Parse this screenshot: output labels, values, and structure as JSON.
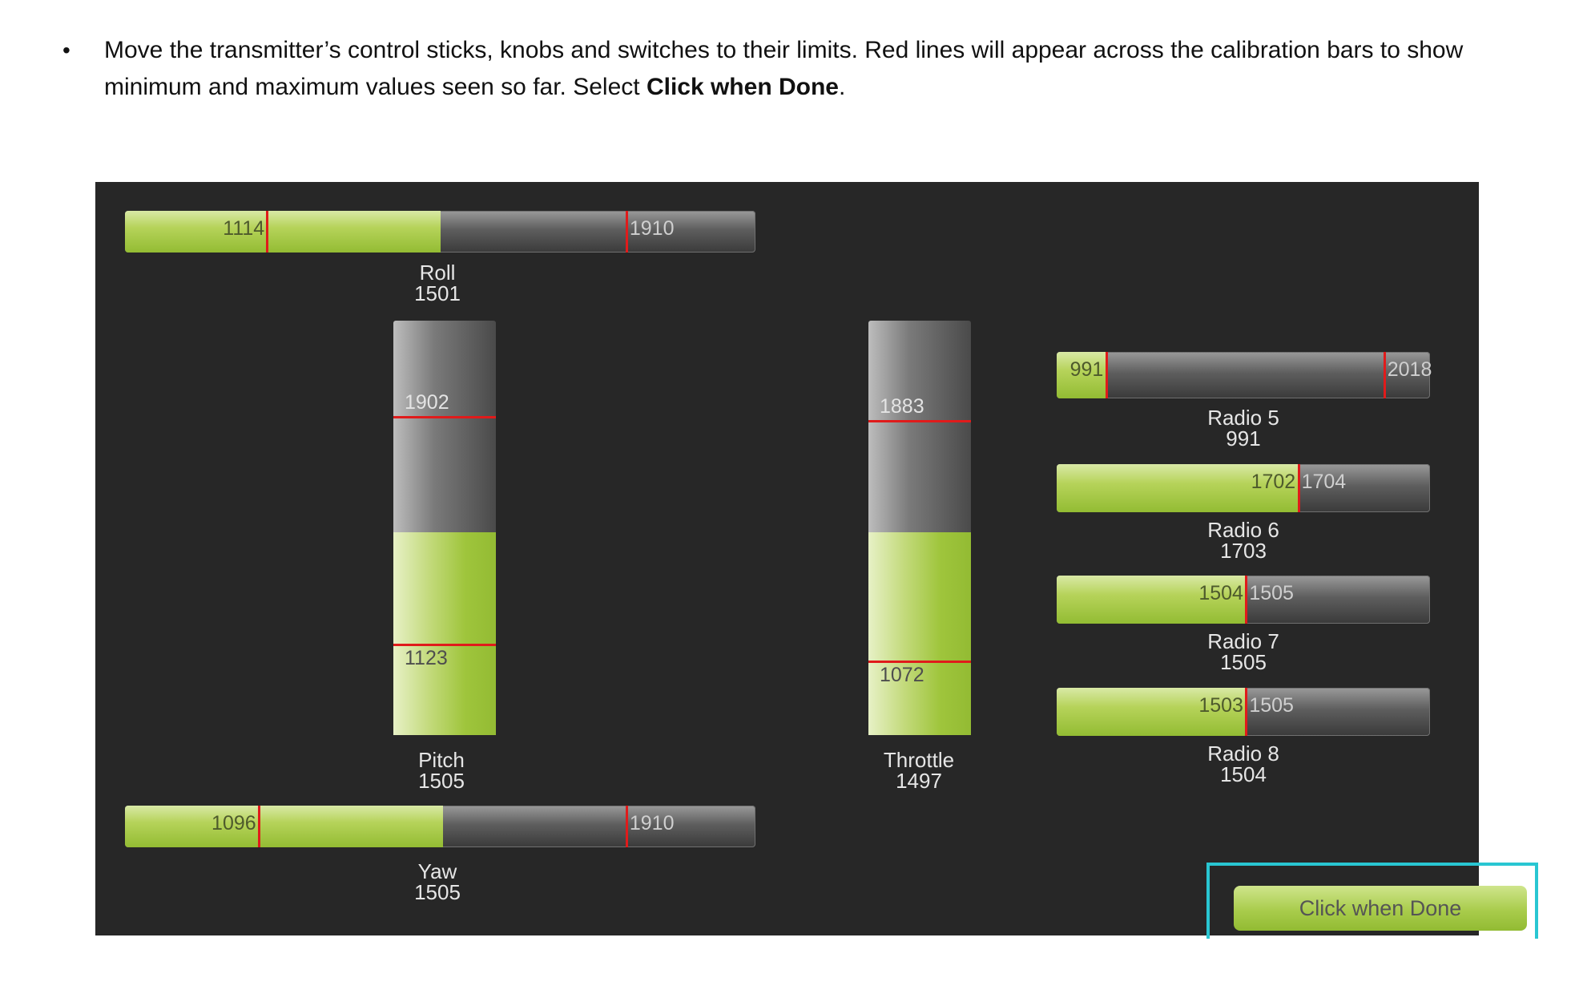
{
  "instruction": {
    "bullet": "•",
    "text_before": "Move the transmitter’s control sticks, knobs and switches to their limits. Red lines will appear across the calibration bars to show minimum and maximum values seen so far. Select ",
    "bold": "Click when Done",
    "text_after": "."
  },
  "colors": {
    "panel_bg": "#272727",
    "fill_green": "#9fc53c",
    "limit_red": "#e01b1b",
    "highlight_cyan": "#29c6d2"
  },
  "roll": {
    "name": "Roll",
    "value": "1501",
    "min_label": "1114",
    "max_label": "1910",
    "fill_fraction": 0.501,
    "min_fraction": 0.224,
    "max_fraction": 0.794
  },
  "yaw": {
    "name": "Yaw",
    "value": "1505",
    "min_label": "1096",
    "max_label": "1910",
    "fill_fraction": 0.504,
    "min_fraction": 0.211,
    "max_fraction": 0.794
  },
  "pitch": {
    "name": "Pitch",
    "value": "1505",
    "max_label": "1902",
    "min_label": "1123",
    "fill_fraction": 0.49,
    "max_fraction": 0.77,
    "min_fraction": 0.22
  },
  "throttle": {
    "name": "Throttle",
    "value": "1497",
    "max_label": "1883",
    "min_label": "1072",
    "fill_fraction": 0.49,
    "max_fraction": 0.76,
    "min_fraction": 0.18
  },
  "radio5": {
    "name": "Radio 5",
    "value": "991",
    "min_label": "991",
    "max_label": "2018",
    "fill_fraction": 0.13,
    "min_fraction": 0.13,
    "max_fraction": 0.875
  },
  "radio6": {
    "name": "Radio 6",
    "value": "1703",
    "min_label": "1702",
    "max_label": "1704",
    "fill_fraction": 0.645,
    "mark_fraction": 0.645
  },
  "radio7": {
    "name": "Radio 7",
    "value": "1505",
    "min_label": "1504",
    "max_label": "1505",
    "fill_fraction": 0.505,
    "mark_fraction": 0.505
  },
  "radio8": {
    "name": "Radio 8",
    "value": "1504",
    "min_label": "1503",
    "max_label": "1505",
    "fill_fraction": 0.505,
    "mark_fraction": 0.505
  },
  "done_button": {
    "label": "Click when Done"
  }
}
